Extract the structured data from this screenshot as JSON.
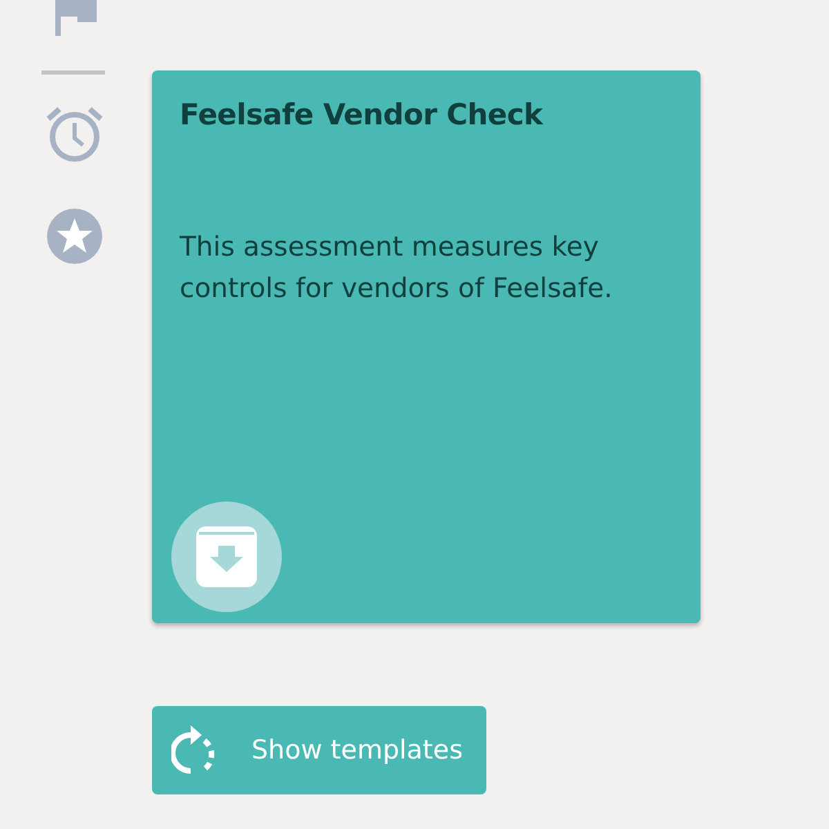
{
  "template_card": {
    "title": "Feelsafe Vendor Check",
    "description": "This assessment measures key controls for vendors of Feelsafe."
  },
  "show_templates_button": {
    "label": "Show templates"
  }
}
